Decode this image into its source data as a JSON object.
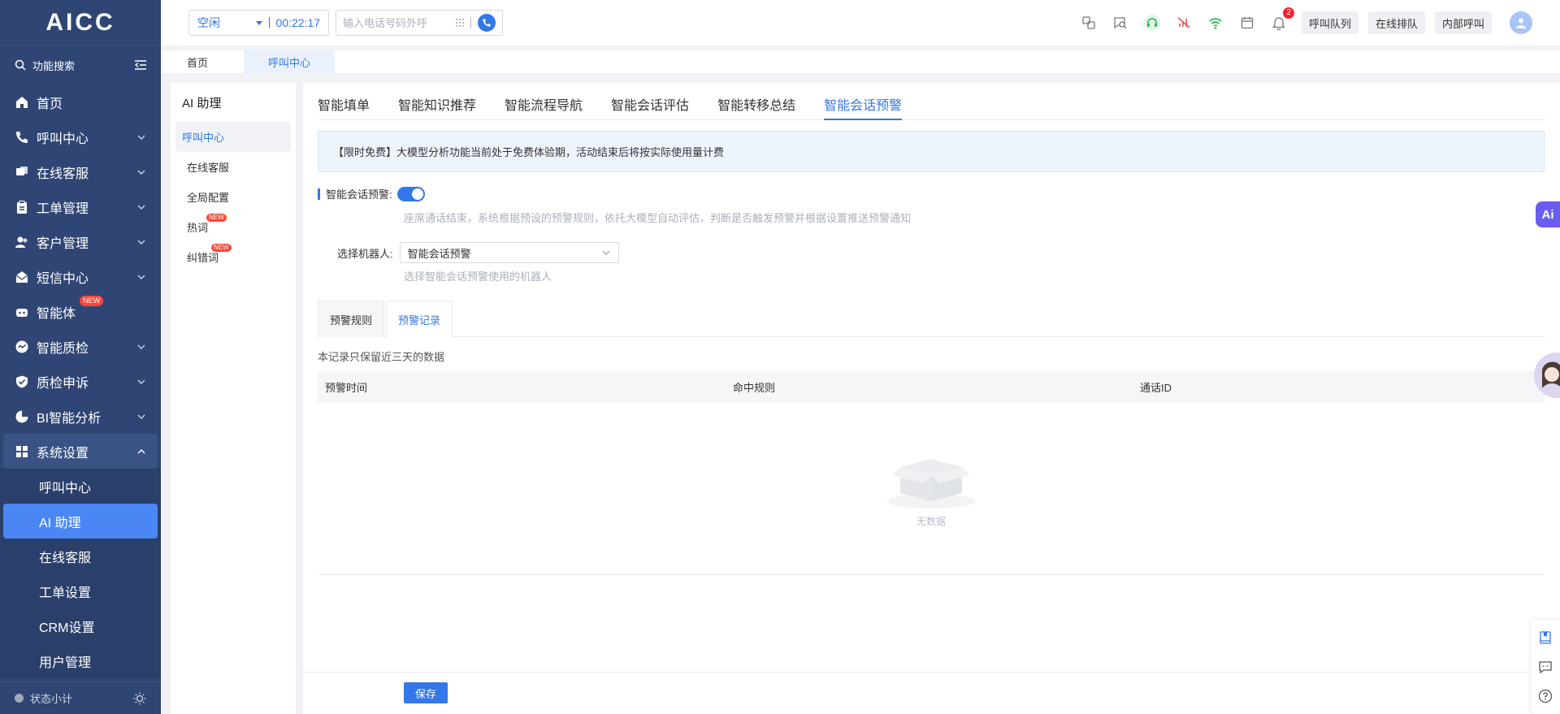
{
  "app": {
    "logo": "AICC"
  },
  "sidebar": {
    "search_label": "功能搜索",
    "items": [
      {
        "label": "首页",
        "icon": "home-icon"
      },
      {
        "label": "呼叫中心",
        "icon": "phone-icon"
      },
      {
        "label": "在线客服",
        "icon": "chat-icon"
      },
      {
        "label": "工单管理",
        "icon": "clipboard-icon"
      },
      {
        "label": "客户管理",
        "icon": "users-icon"
      },
      {
        "label": "短信中心",
        "icon": "mail-icon"
      },
      {
        "label": "智能体",
        "icon": "robot-icon",
        "badge": "NEW"
      },
      {
        "label": "智能质检",
        "icon": "quality-icon"
      },
      {
        "label": "质检申诉",
        "icon": "shield-icon"
      },
      {
        "label": "BI智能分析",
        "icon": "pie-icon"
      },
      {
        "label": "系统设置",
        "icon": "grid-icon"
      }
    ],
    "sub_items": [
      {
        "label": "呼叫中心"
      },
      {
        "label": "AI 助理"
      },
      {
        "label": "在线客服"
      },
      {
        "label": "工单设置"
      },
      {
        "label": "CRM设置"
      },
      {
        "label": "用户管理"
      }
    ],
    "footer_label": "状态小计"
  },
  "topbar": {
    "status": "空闲",
    "timer": "00:22:17",
    "dial_placeholder": "输入电话号码外呼",
    "notification_count": "2",
    "buttons": [
      "呼叫队列",
      "在线排队",
      "内部呼叫"
    ]
  },
  "page_tabs": [
    "首页",
    "呼叫中心"
  ],
  "subpanel": {
    "title": "AI 助理",
    "items": [
      {
        "label": "呼叫中心"
      },
      {
        "label": "在线客服"
      },
      {
        "label": "全局配置"
      },
      {
        "label": "热词",
        "badge": "NEW"
      },
      {
        "label": "纠错词",
        "badge": "NEW"
      }
    ]
  },
  "main": {
    "func_tabs": [
      "智能填单",
      "智能知识推荐",
      "智能流程导航",
      "智能会话评估",
      "智能转移总结",
      "智能会话预警"
    ],
    "notice": "【限时免费】大模型分析功能当前处于免费体验期，活动结束后将按实际使用量计费",
    "warn_label": "智能会话预警:",
    "warn_hint": "座席通话结束，系统根据预设的预警规则，依托大模型自动评估，判断是否触发预警并根据设置推送预警通知",
    "robot_label": "选择机器人:",
    "robot_value": "智能会话预警",
    "robot_hint": "选择智能会话预警使用的机器人",
    "inner_tabs": [
      "预警规则",
      "预警记录"
    ],
    "note": "本记录只保留近三天的数据",
    "columns": [
      "预警时间",
      "命中规则",
      "通话ID"
    ],
    "empty_text": "无数据",
    "save_label": "保存"
  },
  "float": {
    "ai_label": "Ai"
  },
  "colors": {
    "sidebar": "#2f4674",
    "accent": "#3377e8",
    "badge": "#f5483b"
  }
}
